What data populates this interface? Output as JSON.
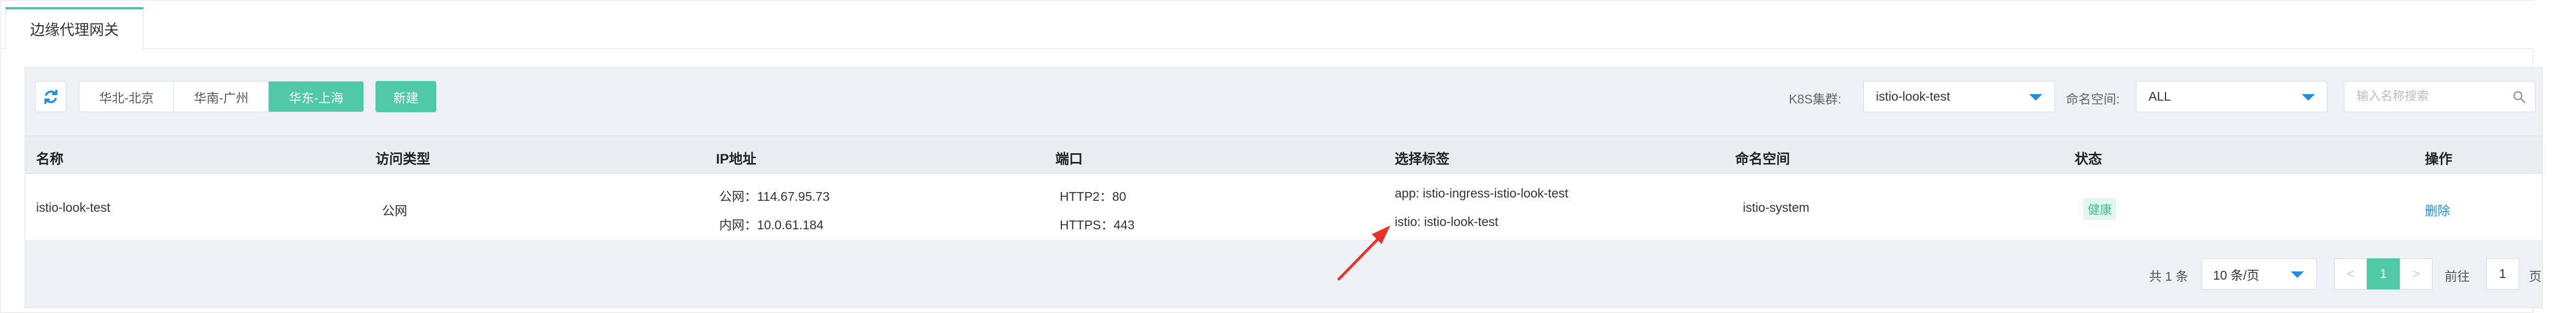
{
  "tab": {
    "label": "边缘代理网关"
  },
  "toolbar": {
    "regions": [
      {
        "label": "华北-北京"
      },
      {
        "label": "华南-广州"
      },
      {
        "label": "华东-上海"
      }
    ],
    "active_region": "华东-上海",
    "new_label": "新建",
    "cluster_label": "K8S集群:",
    "cluster_value": "istio-look-test",
    "namespace_label": "命名空间:",
    "namespace_value": "ALL",
    "search_placeholder": "输入名称搜索"
  },
  "table": {
    "columns": [
      "名称",
      "访问类型",
      "IP地址",
      "端口",
      "选择标签",
      "命名空间",
      "状态",
      "操作"
    ],
    "rows": [
      {
        "name": "istio-look-test",
        "access_type": "公网",
        "ip_public": "公网：114.67.95.73",
        "ip_private": "内网：10.0.61.184",
        "port_http2": "HTTP2：80",
        "port_https": "HTTPS：443",
        "label_1": "app: istio-ingress-istio-look-test",
        "label_2": "istio: istio-look-test",
        "namespace": "istio-system",
        "status": "健康",
        "action": "删除"
      }
    ]
  },
  "pagination": {
    "total_text": "共 1 条",
    "page_size": "10 条/页",
    "prev": "<",
    "current_page": "1",
    "next": ">",
    "goto_label": "前往",
    "goto_value": "1",
    "page_unit": "页"
  },
  "colors": {
    "accent": "#4fc9a6",
    "link": "#1f8fdd",
    "annotation_arrow": "#e8322a"
  }
}
